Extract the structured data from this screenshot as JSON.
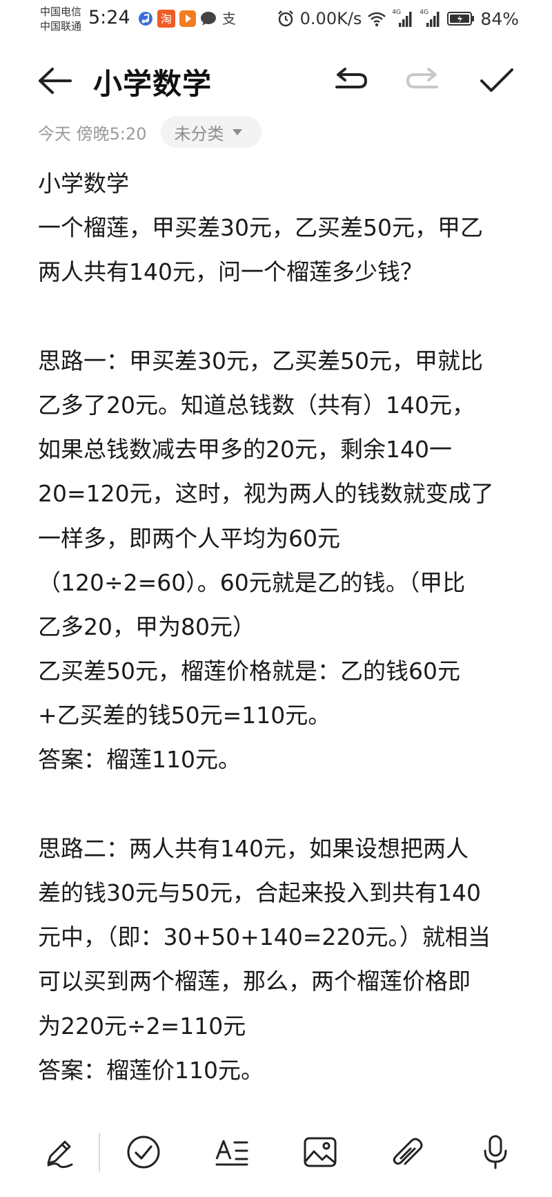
{
  "status_bar": {
    "carrier_1": "中国电信",
    "carrier_2": "中国联通",
    "time": "5:24",
    "network_speed": "0.00K/s",
    "signal_1_label": "4G",
    "signal_2_label": "4G",
    "battery_percent": "84%",
    "app_icons": [
      "music-icon",
      "taobao-icon",
      "video-icon",
      "chat-icon",
      "alipay-icon"
    ],
    "taobao_glyph": "淘",
    "alipay_glyph": "支"
  },
  "header": {
    "title": "小学数学"
  },
  "meta": {
    "date": "今天 傍晚5:20",
    "category": "未分类"
  },
  "note": {
    "lines": [
      "小学数学",
      "一个榴莲，甲买差30元，乙买差50元，甲乙",
      "两人共有140元，问一个榴莲多少钱？",
      "",
      "思路一：甲买差30元，乙买差50元，甲就比",
      "乙多了20元。知道总钱数（共有）140元，",
      "如果总钱数减去甲多的20元，剩余140一",
      "20=120元，这时，视为两人的钱数就变成了",
      "一样多，即两个人平均为60元",
      "（120÷2=60）。60元就是乙的钱。（甲比",
      "乙多20，甲为80元）",
      "乙买差50元，榴莲价格就是：乙的钱60元",
      "+乙买差的钱50元=110元。",
      "答案：榴莲110元。",
      "",
      "思路二：两人共有140元，如果设想把两人",
      "差的钱30元与50元，合起来投入到共有140",
      "元中，（即：30+50+140=220元。）就相当",
      "可以买到两个榴莲，那么，两个榴莲价格即",
      "为220元÷2=110元",
      "答案：榴莲价110元。"
    ]
  },
  "toolbar": {
    "icons": [
      "pen-icon",
      "checklist-icon",
      "text-format-icon",
      "image-icon",
      "attachment-icon",
      "microphone-icon"
    ]
  },
  "colors": {
    "text": "#1a1a1a",
    "meta_text": "#9a9a9a",
    "chip_bg": "#f3f3f3",
    "redo_disabled": "#c8c8c8"
  }
}
